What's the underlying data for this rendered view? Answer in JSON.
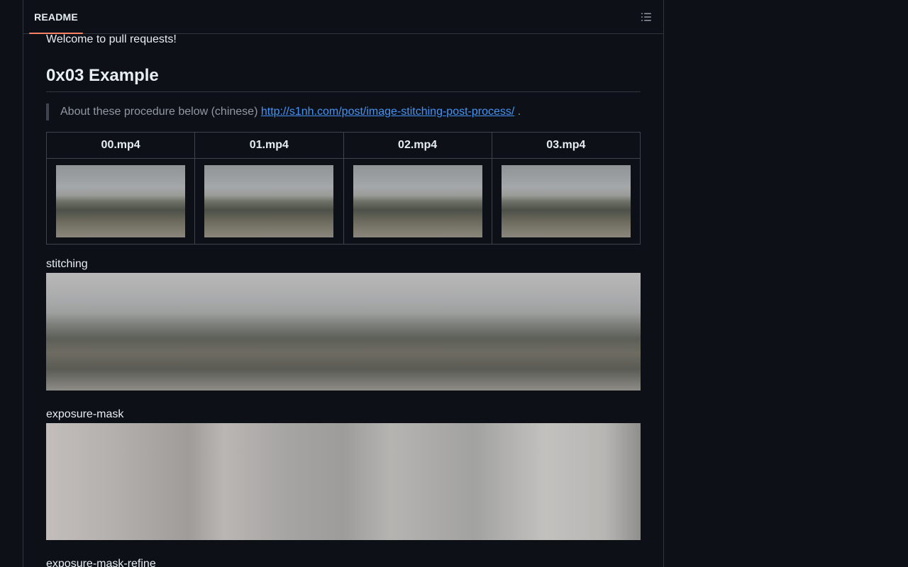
{
  "readme": {
    "tab_label": "README",
    "outline_icon": "list-unordered-icon"
  },
  "article": {
    "intro_text": "Welcome to pull requests!",
    "heading": "0x03 Example",
    "quote_text": "About these procedure below (chinese) ",
    "quote_link": "http://s1nh.com/post/image-stitching-post-process/",
    "quote_suffix": " .",
    "table": {
      "headers": [
        "00.mp4",
        "01.mp4",
        "02.mp4",
        "03.mp4"
      ]
    },
    "stitching_label": "stitching",
    "exposure_mask_label": "exposure-mask",
    "exposure_mask_refine_label": "exposure-mask-refine"
  },
  "colors": {
    "background": "#0d1117",
    "border": "#30363d",
    "tab_accent": "#f78166",
    "link": "#4493f8",
    "muted_text": "#9198a1"
  }
}
